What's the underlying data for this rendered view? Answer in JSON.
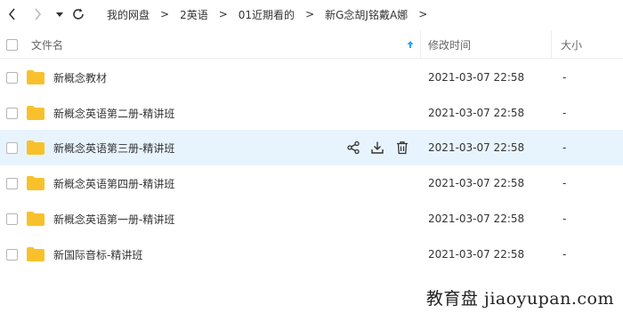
{
  "breadcrumb": [
    "我的网盘",
    "2英语",
    "01近期看的",
    "新G念胡J铭戴A娜"
  ],
  "breadcrumb_sep": ">",
  "columns": {
    "name": "文件名",
    "modified": "修改时间",
    "size": "大小"
  },
  "files": [
    {
      "name": "新概念教材",
      "modified": "2021-03-07 22:58",
      "size": "-"
    },
    {
      "name": "新概念英语第二册-精讲班",
      "modified": "2021-03-07 22:58",
      "size": "-"
    },
    {
      "name": "新概念英语第三册-精讲班",
      "modified": "2021-03-07 22:58",
      "size": "-"
    },
    {
      "name": "新概念英语第四册-精讲班",
      "modified": "2021-03-07 22:58",
      "size": "-"
    },
    {
      "name": "新概念英语第一册-精讲班",
      "modified": "2021-03-07 22:58",
      "size": "-"
    },
    {
      "name": "新国际音标-精讲班",
      "modified": "2021-03-07 22:58",
      "size": "-"
    }
  ],
  "icons": {
    "back": "chevron-left-icon",
    "forward": "chevron-right-icon",
    "history": "caret-down-icon",
    "refresh": "refresh-icon",
    "folder": "folder-icon",
    "share": "share-icon",
    "download": "download-icon",
    "delete": "trash-icon",
    "sort": "sort-up-icon"
  },
  "colors": {
    "folder": "#f8c12c",
    "hover_row": "#e8f4fd",
    "sort_arrow": "#2ba0f0"
  },
  "watermark": "教育盘 jiaoyupan.com"
}
